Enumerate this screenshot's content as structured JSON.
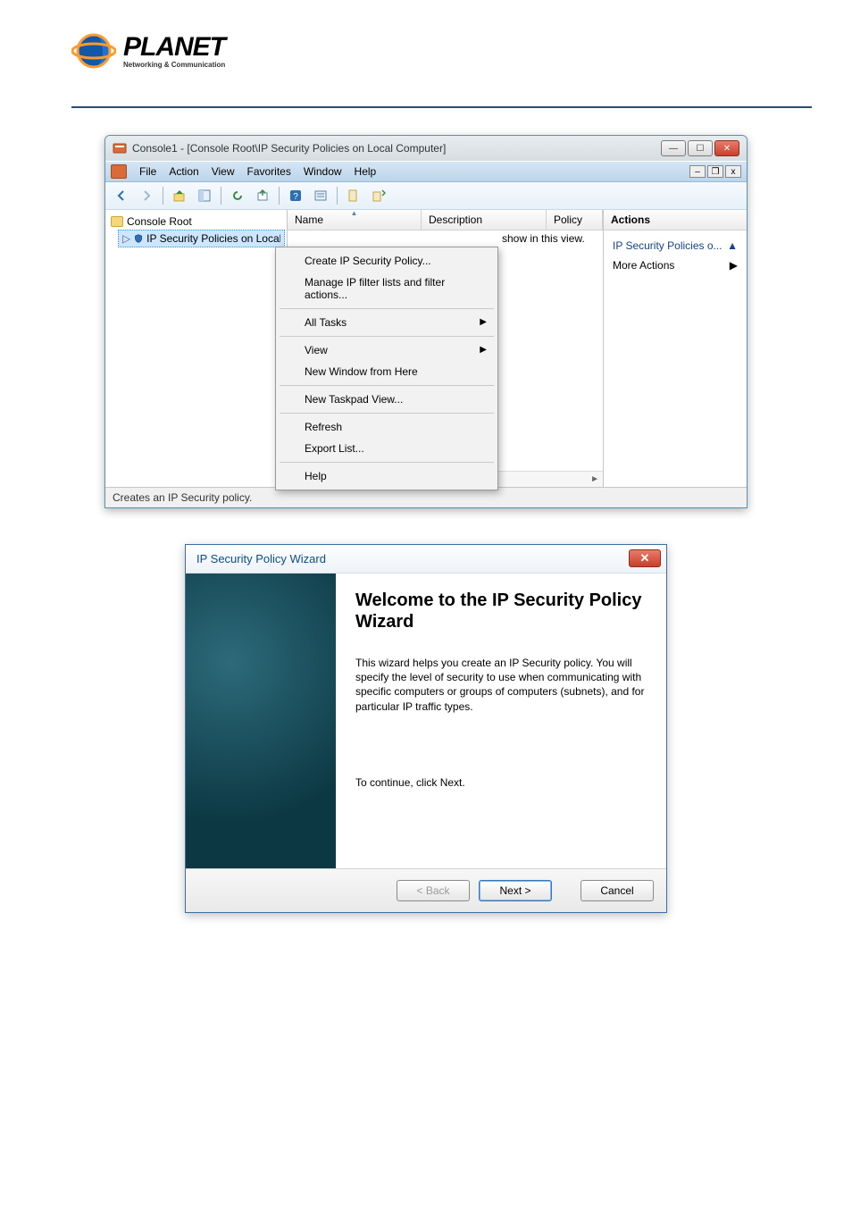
{
  "logo": {
    "brand": "PLANET",
    "tagline": "Networking & Communication"
  },
  "mmc": {
    "title": "Console1 - [Console Root\\IP Security Policies on Local Computer]",
    "menus": [
      "File",
      "Action",
      "View",
      "Favorites",
      "Window",
      "Help"
    ],
    "tree": {
      "root": "Console Root",
      "child": "IP Security Policies on Local Computer"
    },
    "columns": {
      "name": "Name",
      "description": "Description",
      "policy": "Policy"
    },
    "desc_row_text": "show in this view.",
    "context_menu": {
      "items": [
        {
          "label": "Create IP Security Policy...",
          "submenu": false
        },
        {
          "label": "Manage IP filter lists and filter actions...",
          "submenu": false
        },
        {
          "sep": true
        },
        {
          "label": "All Tasks",
          "submenu": true
        },
        {
          "sep": true
        },
        {
          "label": "View",
          "submenu": true
        },
        {
          "label": "New Window from Here",
          "submenu": false
        },
        {
          "sep": true
        },
        {
          "label": "New Taskpad View...",
          "submenu": false
        },
        {
          "sep": true
        },
        {
          "label": "Refresh",
          "submenu": false
        },
        {
          "label": "Export List...",
          "submenu": false
        },
        {
          "sep": true
        },
        {
          "label": "Help",
          "submenu": false
        }
      ]
    },
    "actions": {
      "header": "Actions",
      "link1": "IP Security Policies o...",
      "link2": "More Actions"
    },
    "status": "Creates an IP Security policy."
  },
  "wizard": {
    "title": "IP Security Policy Wizard",
    "heading": "Welcome to the IP Security Policy Wizard",
    "body": "This wizard helps you create an IP Security policy. You will specify the level of security to use when communicating with specific computers or groups of computers (subnets), and for particular IP traffic types.",
    "continue": "To continue, click Next.",
    "buttons": {
      "back": "< Back",
      "next": "Next >",
      "cancel": "Cancel"
    }
  }
}
